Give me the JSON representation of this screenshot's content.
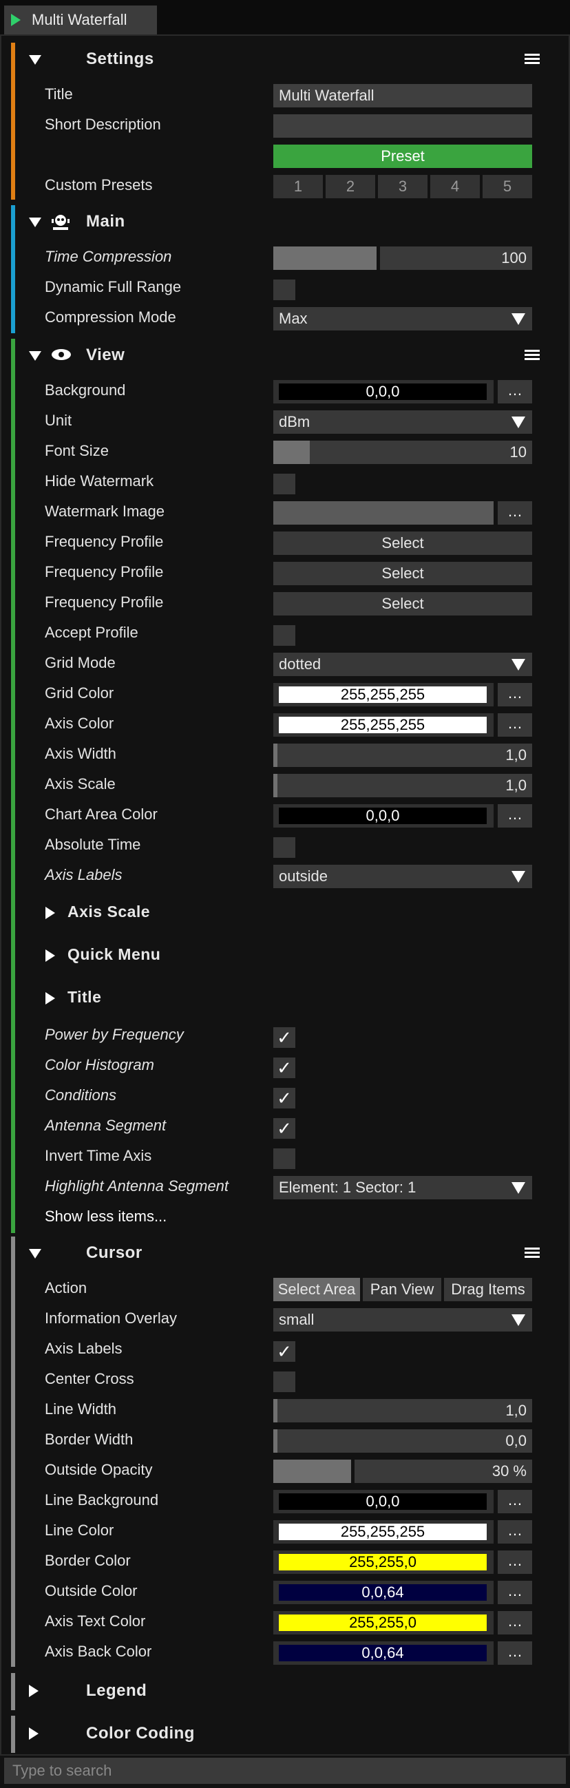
{
  "tab": {
    "title": "Multi Waterfall"
  },
  "settings": {
    "title": "Settings",
    "rows": {
      "title_label": "Title",
      "title_value": "Multi Waterfall",
      "short_desc_label": "Short Description",
      "short_desc_value": "",
      "preset_label": "Preset",
      "custom_presets_label": "Custom Presets",
      "presets": [
        "1",
        "2",
        "3",
        "4",
        "5"
      ]
    }
  },
  "main": {
    "title": "Main",
    "time_compression_label": "Time Compression",
    "time_compression_value": "100",
    "time_compression_fraction": 0.4,
    "dynamic_full_range_label": "Dynamic Full Range",
    "compression_mode_label": "Compression Mode",
    "compression_mode_value": "Max"
  },
  "view": {
    "title": "View",
    "background_label": "Background",
    "background_value": "0,0,0",
    "unit_label": "Unit",
    "unit_value": "dBm",
    "font_size_label": "Font Size",
    "font_size_value": "10",
    "font_size_fraction": 0.14,
    "hide_watermark_label": "Hide Watermark",
    "watermark_image_label": "Watermark Image",
    "freq_profile_label": "Frequency Profile",
    "select_label": "Select",
    "accept_profile_label": "Accept Profile",
    "grid_mode_label": "Grid Mode",
    "grid_mode_value": "dotted",
    "grid_color_label": "Grid Color",
    "grid_color_value": "255,255,255",
    "axis_color_label": "Axis Color",
    "axis_color_value": "255,255,255",
    "axis_width_label": "Axis Width",
    "axis_width_value": "1,0",
    "axis_scale_label": "Axis Scale",
    "axis_scale_value": "1,0",
    "chart_area_color_label": "Chart Area Color",
    "chart_area_color_value": "0,0,0",
    "absolute_time_label": "Absolute Time",
    "axis_labels_label": "Axis Labels",
    "axis_labels_value": "outside",
    "sub_axis_scale": "Axis Scale",
    "sub_quick_menu": "Quick Menu",
    "sub_title": "Title",
    "power_by_freq_label": "Power by Frequency",
    "color_histogram_label": "Color Histogram",
    "conditions_label": "Conditions",
    "antenna_segment_label": "Antenna Segment",
    "invert_time_axis_label": "Invert Time Axis",
    "highlight_antenna_label": "Highlight Antenna Segment",
    "highlight_antenna_value": "Element: 1 Sector: 1",
    "show_less_label": "Show less items..."
  },
  "cursor": {
    "title": "Cursor",
    "action_label": "Action",
    "actions": [
      "Select Area",
      "Pan View",
      "Drag Items"
    ],
    "info_overlay_label": "Information Overlay",
    "info_overlay_value": "small",
    "axis_labels_label": "Axis Labels",
    "center_cross_label": "Center Cross",
    "line_width_label": "Line Width",
    "line_width_value": "1,0",
    "border_width_label": "Border Width",
    "border_width_value": "0,0",
    "outside_opacity_label": "Outside Opacity",
    "outside_opacity_value": "30 %",
    "outside_opacity_fraction": 0.3,
    "line_background_label": "Line Background",
    "line_background_value": "0,0,0",
    "line_color_label": "Line Color",
    "line_color_value": "255,255,255",
    "border_color_label": "Border Color",
    "border_color_value": "255,255,0",
    "outside_color_label": "Outside Color",
    "outside_color_value": "0,0,64",
    "axis_text_color_label": "Axis Text Color",
    "axis_text_color_value": "255,255,0",
    "axis_back_color_label": "Axis Back Color",
    "axis_back_color_value": "0,0,64"
  },
  "legend": {
    "title": "Legend"
  },
  "color_coding": {
    "title": "Color Coding"
  },
  "search": {
    "placeholder": "Type to search"
  },
  "colors": {
    "settings_accent": "#e07f14",
    "main_accent": "#1b9fd1",
    "view_accent": "#3aa43f",
    "cursor_accent": "#8a8a8a",
    "preset_button": "#3aa43f"
  },
  "checks": {
    "mark": "✓"
  },
  "icons": {
    "play": "play-icon",
    "main": "robot-icon",
    "view": "eye-icon",
    "menu": "hamburger-icon",
    "dots": "…"
  }
}
